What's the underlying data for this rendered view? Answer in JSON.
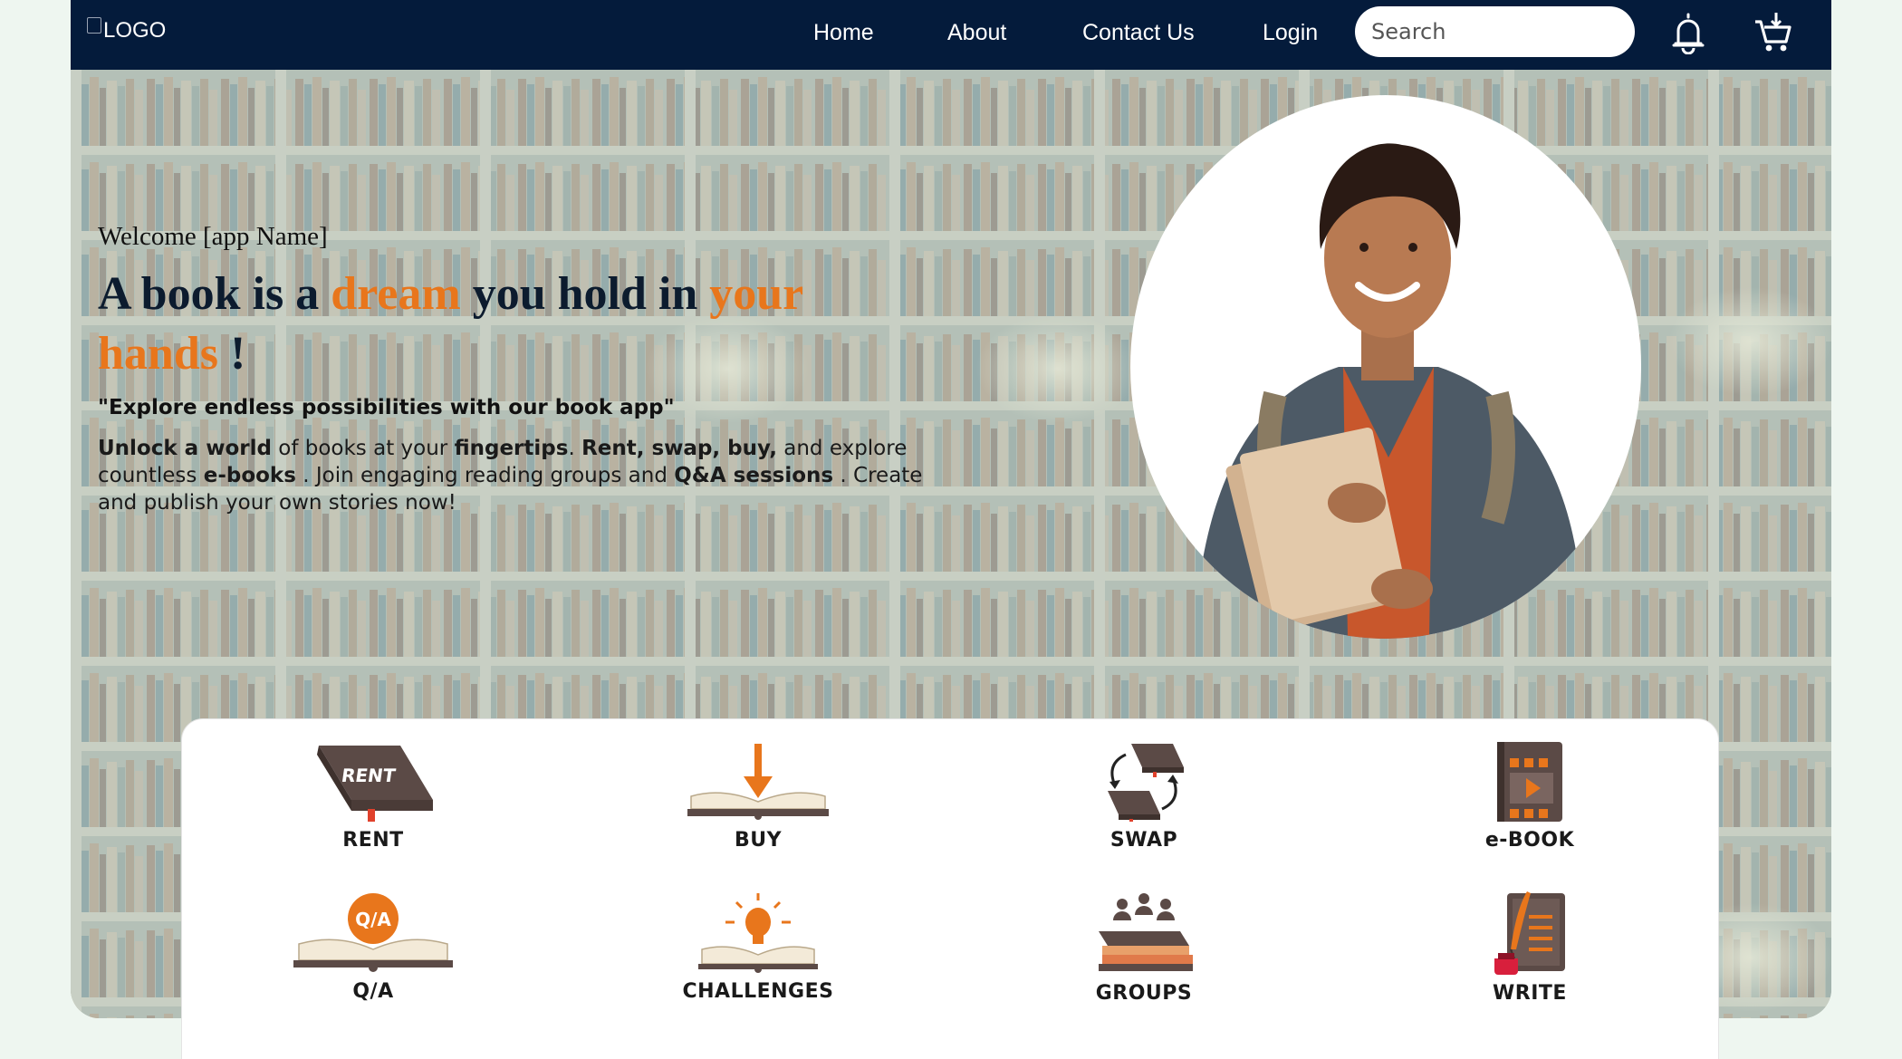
{
  "navbar": {
    "logo_alt": "LOGO",
    "links": [
      {
        "label": "Home"
      },
      {
        "label": "About"
      },
      {
        "label": "Contact Us"
      },
      {
        "label": "Login"
      }
    ],
    "search_placeholder": "Search",
    "icons": [
      "bell-icon",
      "cart-icon"
    ]
  },
  "hero": {
    "welcome": "Welcome [app Name]",
    "headline": {
      "p1": "A book is a ",
      "accent1": "dream",
      "p2": " you hold in ",
      "accent2": "your hands",
      "p3": " !"
    },
    "quote": "\"Explore endless possibilities with our book app\"",
    "desc": {
      "b1": "Unlock a world",
      "t1": " of books at your ",
      "b2": "fingertips",
      "t2": ". ",
      "b3": "Rent, swap, buy,",
      "t3": " and explore countless ",
      "b4": "e-books",
      "t4": " . Join engaging reading groups and ",
      "b5": "Q&A sessions",
      "t5": " . Create and publish your own stories now!"
    }
  },
  "features": [
    {
      "label": "RENT",
      "icon": "rent-book-icon",
      "icon_text": "RENT"
    },
    {
      "label": "BUY",
      "icon": "buy-book-icon"
    },
    {
      "label": "SWAP",
      "icon": "swap-books-icon"
    },
    {
      "label": "e-BOOK",
      "icon": "ebook-icon"
    },
    {
      "label": "Q/A",
      "icon": "qa-book-icon",
      "icon_text": "Q/A"
    },
    {
      "label": "CHALLENGES",
      "icon": "challenges-bulb-icon"
    },
    {
      "label": "GROUPS",
      "icon": "groups-icon"
    },
    {
      "label": "WRITE",
      "icon": "write-quill-icon"
    }
  ],
  "colors": {
    "navbar_bg": "#041b3b",
    "accent": "#e8761c",
    "icon_brown": "#5b4a46",
    "page_bg": "#eef6f0"
  }
}
